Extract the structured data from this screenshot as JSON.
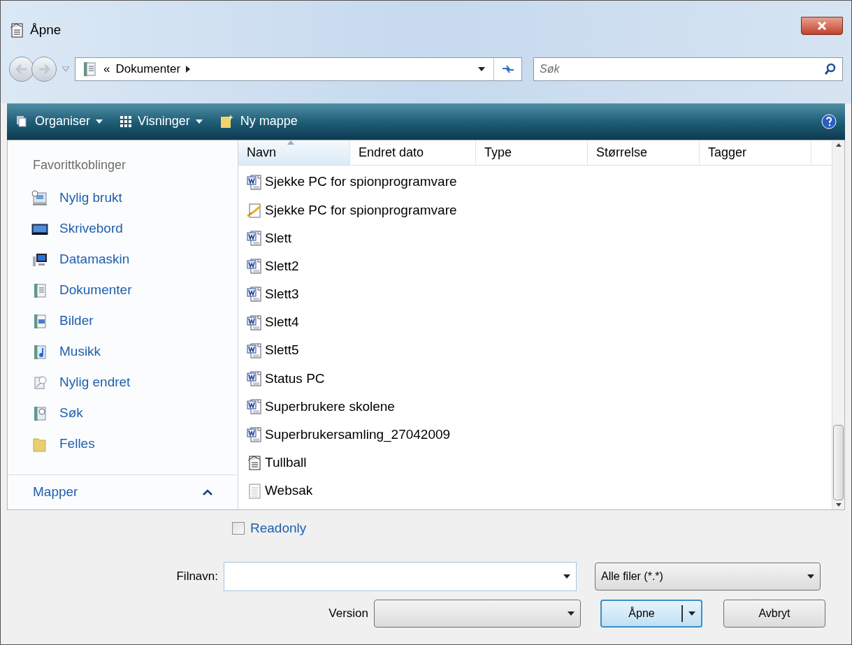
{
  "window": {
    "title": "Åpne"
  },
  "address": {
    "prefix": "«",
    "path": "Dokumenter",
    "search_placeholder": "Søk"
  },
  "toolbar": [
    {
      "label": "Organiser",
      "kind": "organise",
      "dropdown": true
    },
    {
      "label": "Visninger",
      "kind": "views",
      "dropdown": true
    },
    {
      "label": "Ny mappe",
      "kind": "newfolder",
      "dropdown": false
    }
  ],
  "sidebar": {
    "heading": "Favorittkoblinger",
    "items": [
      {
        "label": "Nylig brukt",
        "kind": "recent"
      },
      {
        "label": "Skrivebord",
        "kind": "desktop"
      },
      {
        "label": "Datamaskin",
        "kind": "computer"
      },
      {
        "label": "Dokumenter",
        "kind": "docs"
      },
      {
        "label": "Bilder",
        "kind": "pictures"
      },
      {
        "label": "Musikk",
        "kind": "music"
      },
      {
        "label": "Nylig endret",
        "kind": "changed"
      },
      {
        "label": "Søk",
        "kind": "search"
      },
      {
        "label": "Felles",
        "kind": "folder"
      }
    ],
    "folders": {
      "label": "Mapper",
      "expanded": true
    }
  },
  "table": {
    "columns": [
      {
        "label": "Navn",
        "sorted": true
      },
      {
        "label": "Endret dato",
        "sorted": false
      },
      {
        "label": "Type",
        "sorted": false
      },
      {
        "label": "Størrelse",
        "sorted": false
      },
      {
        "label": "Tagger",
        "sorted": false
      }
    ],
    "rows": [
      {
        "name": "Sjekke PC for spionprogramvare",
        "kind": "word"
      },
      {
        "name": "Sjekke PC for spionprogramvare",
        "kind": "draft"
      },
      {
        "name": "Slett",
        "kind": "word"
      },
      {
        "name": "Slett2",
        "kind": "word"
      },
      {
        "name": "Slett3",
        "kind": "word"
      },
      {
        "name": "Slett4",
        "kind": "word"
      },
      {
        "name": "Slett5",
        "kind": "word"
      },
      {
        "name": "Status PC",
        "kind": "word"
      },
      {
        "name": "Superbrukere skolene",
        "kind": "word"
      },
      {
        "name": "Superbrukersamling_27042009",
        "kind": "word"
      },
      {
        "name": "Tullball",
        "kind": "form"
      },
      {
        "name": "Websak",
        "kind": "text"
      }
    ]
  },
  "readonly": {
    "label": "Readonly",
    "checked": false
  },
  "filename": {
    "label": "Filnavn:"
  },
  "filter": {
    "value": "Alle filer (*.*)"
  },
  "version": {
    "label": "Version"
  },
  "buttons": {
    "open": "Åpne",
    "cancel": "Avbryt"
  }
}
